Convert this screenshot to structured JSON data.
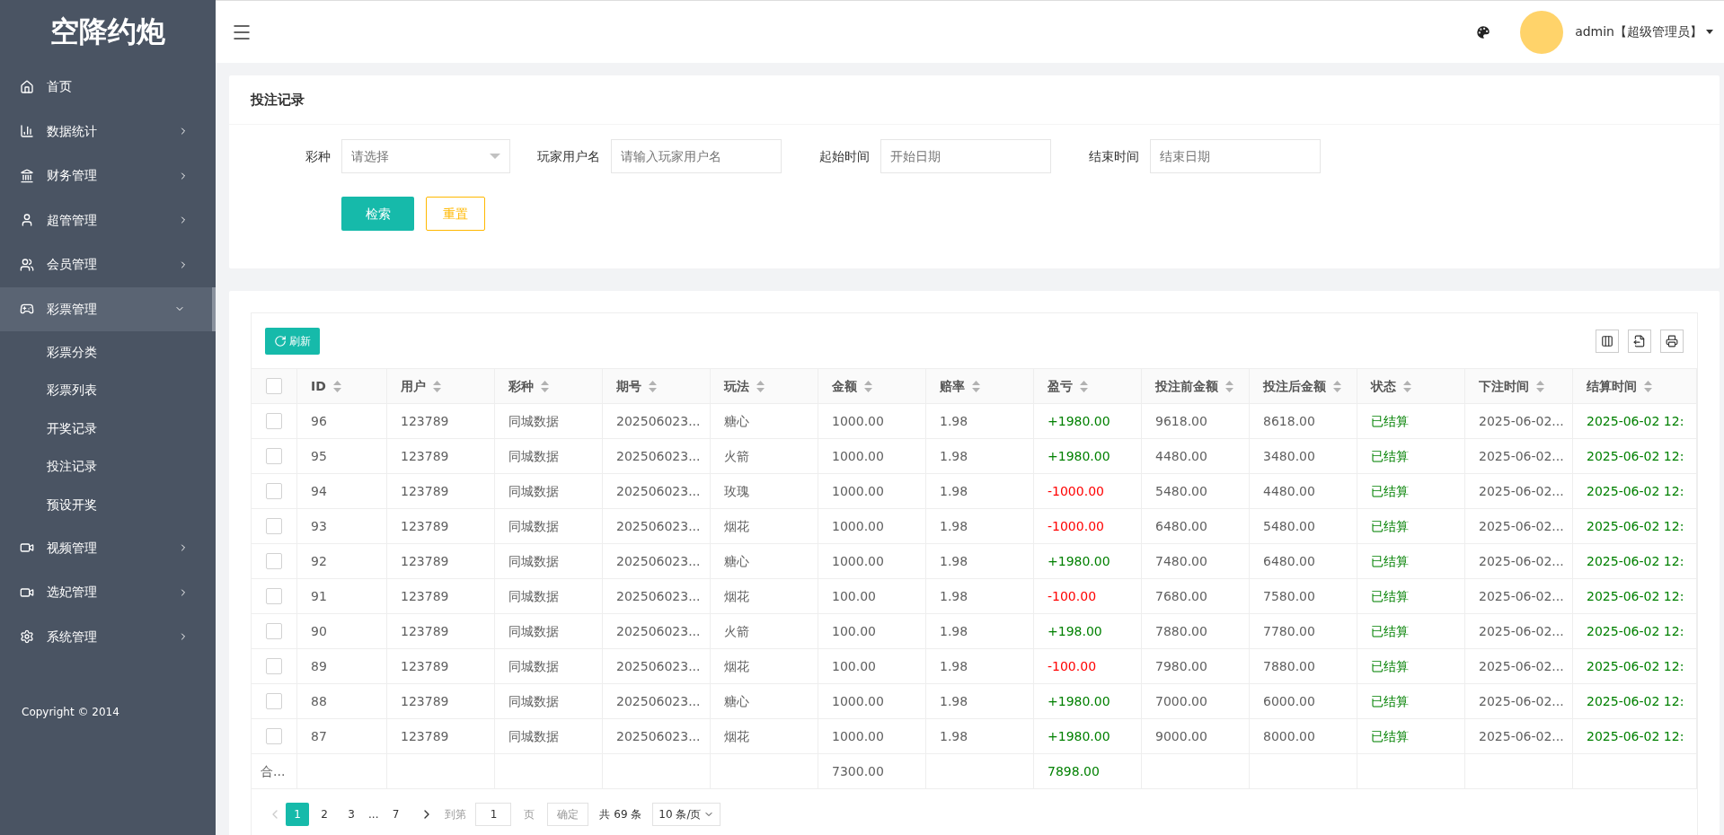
{
  "brand": "空降约炮",
  "sidebar": {
    "items": [
      {
        "label": "首页"
      },
      {
        "label": "数据统计",
        "expanded": false
      },
      {
        "label": "财务管理",
        "expanded": false
      },
      {
        "label": "超管管理",
        "expanded": false
      },
      {
        "label": "会员管理",
        "expanded": false
      },
      {
        "label": "彩票管理",
        "expanded": true,
        "children": [
          {
            "label": "彩票分类"
          },
          {
            "label": "彩票列表"
          },
          {
            "label": "开奖记录"
          },
          {
            "label": "投注记录"
          },
          {
            "label": "预设开奖"
          }
        ]
      },
      {
        "label": "视频管理",
        "expanded": false
      },
      {
        "label": "选妃管理",
        "expanded": false
      },
      {
        "label": "系统管理",
        "expanded": false
      }
    ],
    "copyright": "Copyright © 2014"
  },
  "header": {
    "user": "admin【超级管理员】"
  },
  "search_card": {
    "title": "投注记录",
    "fields": [
      {
        "label": "彩种",
        "kind": "select",
        "placeholder": "请选择"
      },
      {
        "label": "玩家用户名",
        "kind": "input",
        "placeholder": "请输入玩家用户名"
      },
      {
        "label": "起始时间",
        "kind": "input",
        "placeholder": "开始日期"
      },
      {
        "label": "结束时间",
        "kind": "input",
        "placeholder": "结束日期"
      }
    ],
    "buttons": [
      {
        "label": "检索",
        "kind": "primary"
      },
      {
        "label": "重置",
        "kind": "outline"
      }
    ]
  },
  "table": {
    "refresh": "刷新",
    "all_checked": false,
    "columns": [
      "ID",
      "用户",
      "彩种",
      "期号",
      "玩法",
      "金额",
      "赔率",
      "盈亏",
      "投注前金额",
      "投注后金额",
      "状态",
      "下注时间",
      "结算时间"
    ],
    "rows": [
      {
        "checked": false,
        "id": "96",
        "user": "123789",
        "lottery": "同城数据",
        "issue": "202506023...",
        "play": "糖心",
        "amount": "1000.00",
        "odds": "1.98",
        "profit": "+1980.00",
        "color": "#008000",
        "before": "9618.00",
        "after": "8618.00",
        "status": "已结算",
        "bet_time": "2025-06-02...",
        "settle_time": "2025-06-02 12:"
      },
      {
        "checked": false,
        "id": "95",
        "user": "123789",
        "lottery": "同城数据",
        "issue": "202506023...",
        "play": "火箭",
        "amount": "1000.00",
        "odds": "1.98",
        "profit": "+1980.00",
        "color": "#008000",
        "before": "4480.00",
        "after": "3480.00",
        "status": "已结算",
        "bet_time": "2025-06-02...",
        "settle_time": "2025-06-02 12:"
      },
      {
        "checked": false,
        "id": "94",
        "user": "123789",
        "lottery": "同城数据",
        "issue": "202506023...",
        "play": "玫瑰",
        "amount": "1000.00",
        "odds": "1.98",
        "profit": "-1000.00",
        "color": "#ff0000",
        "before": "5480.00",
        "after": "4480.00",
        "status": "已结算",
        "bet_time": "2025-06-02...",
        "settle_time": "2025-06-02 12:"
      },
      {
        "checked": false,
        "id": "93",
        "user": "123789",
        "lottery": "同城数据",
        "issue": "202506023...",
        "play": "烟花",
        "amount": "1000.00",
        "odds": "1.98",
        "profit": "-1000.00",
        "color": "#ff0000",
        "before": "6480.00",
        "after": "5480.00",
        "status": "已结算",
        "bet_time": "2025-06-02...",
        "settle_time": "2025-06-02 12:"
      },
      {
        "checked": false,
        "id": "92",
        "user": "123789",
        "lottery": "同城数据",
        "issue": "202506023...",
        "play": "糖心",
        "amount": "1000.00",
        "odds": "1.98",
        "profit": "+1980.00",
        "color": "#008000",
        "before": "7480.00",
        "after": "6480.00",
        "status": "已结算",
        "bet_time": "2025-06-02...",
        "settle_time": "2025-06-02 12:"
      },
      {
        "checked": false,
        "id": "91",
        "user": "123789",
        "lottery": "同城数据",
        "issue": "202506023...",
        "play": "烟花",
        "amount": "100.00",
        "odds": "1.98",
        "profit": "-100.00",
        "color": "#ff0000",
        "before": "7680.00",
        "after": "7580.00",
        "status": "已结算",
        "bet_time": "2025-06-02...",
        "settle_time": "2025-06-02 12:"
      },
      {
        "checked": false,
        "id": "90",
        "user": "123789",
        "lottery": "同城数据",
        "issue": "202506023...",
        "play": "火箭",
        "amount": "100.00",
        "odds": "1.98",
        "profit": "+198.00",
        "color": "#008000",
        "before": "7880.00",
        "after": "7780.00",
        "status": "已结算",
        "bet_time": "2025-06-02...",
        "settle_time": "2025-06-02 12:"
      },
      {
        "checked": false,
        "id": "89",
        "user": "123789",
        "lottery": "同城数据",
        "issue": "202506023...",
        "play": "烟花",
        "amount": "100.00",
        "odds": "1.98",
        "profit": "-100.00",
        "color": "#ff0000",
        "before": "7980.00",
        "after": "7880.00",
        "status": "已结算",
        "bet_time": "2025-06-02...",
        "settle_time": "2025-06-02 12:"
      },
      {
        "checked": false,
        "id": "88",
        "user": "123789",
        "lottery": "同城数据",
        "issue": "202506023...",
        "play": "糖心",
        "amount": "1000.00",
        "odds": "1.98",
        "profit": "+1980.00",
        "color": "#008000",
        "before": "7000.00",
        "after": "6000.00",
        "status": "已结算",
        "bet_time": "2025-06-02...",
        "settle_time": "2025-06-02 12:"
      },
      {
        "checked": false,
        "id": "87",
        "user": "123789",
        "lottery": "同城数据",
        "issue": "202506023...",
        "play": "烟花",
        "amount": "1000.00",
        "odds": "1.98",
        "profit": "+1980.00",
        "color": "#008000",
        "before": "9000.00",
        "after": "8000.00",
        "status": "已结算",
        "bet_time": "2025-06-02...",
        "settle_time": "2025-06-02 12:"
      }
    ],
    "total": {
      "label": "合...",
      "amount": "7300.00",
      "profit": "7898.00"
    }
  },
  "pagination": {
    "pages": [
      {
        "label": "1",
        "selected": true
      },
      {
        "label": "2",
        "selected": false
      },
      {
        "label": "3",
        "selected": false
      },
      {
        "label": "...",
        "kind": "ellipsis"
      },
      {
        "label": "7",
        "selected": false
      }
    ],
    "goto_label": "到第",
    "goto_value": "1",
    "page_unit": "页",
    "confirm": "确定",
    "total": "共 69 条",
    "page_size": "10 条/页"
  }
}
